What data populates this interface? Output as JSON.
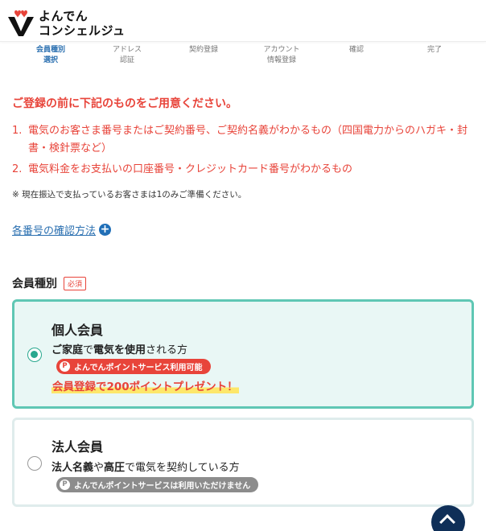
{
  "header": {
    "logo_line1": "よんでん",
    "logo_line2": "コンシェルジュ",
    "brand_colors": {
      "accent": "#e8443a",
      "dark": "#111111"
    }
  },
  "steps": [
    {
      "label": "会員種別\n選択",
      "active": true
    },
    {
      "label": "アドレス\n認証",
      "active": false
    },
    {
      "label": "契約登録",
      "active": false
    },
    {
      "label": "アカウント\n情報登録",
      "active": false
    },
    {
      "label": "確認",
      "active": false
    },
    {
      "label": "完了",
      "active": false
    }
  ],
  "notice": {
    "title": "ご登録の前に下記のものをご用意ください。",
    "items": [
      {
        "num": "1.",
        "text": "電気のお客さま番号またはご契約番号、ご契約名義がわかるもの（四国電力からのハガキ・封書・検針票など）"
      },
      {
        "num": "2.",
        "text": "電気料金をお支払いの口座番号・クレジットカード番号がわかるもの"
      }
    ],
    "note": "※ 現在振込で支払っているお客さまは1のみご準備ください。"
  },
  "links": {
    "how_to_check": "各番号の確認方法"
  },
  "member_type": {
    "label": "会員種別",
    "required": "必須",
    "options": [
      {
        "title": "個人会員",
        "desc_bold1": "ご家庭",
        "desc_mid1": "で",
        "desc_bold2": "電気を使用",
        "desc_tail": "される方",
        "pill_icon": "P",
        "pill": "よんでんポイントサービス利用可能",
        "promo": "会員登録で200ポイントプレゼント！",
        "selected": true
      },
      {
        "title": "法人会員",
        "desc_bold1": "法人名義",
        "desc_mid1": "や",
        "desc_bold2": "高圧",
        "desc_tail": "で電気を契約している方",
        "pill_icon": "P",
        "pill": "よんでんポイントサービスは利用いただけません",
        "selected": false
      }
    ]
  },
  "icons": {
    "plus": "plus-circle-icon",
    "scroll_top": "chevron-up-icon"
  }
}
